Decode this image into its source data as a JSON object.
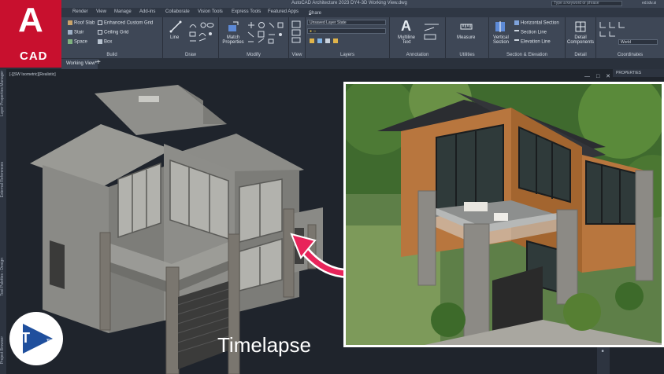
{
  "app": {
    "logo_letter": "A",
    "logo_text": "CAD",
    "window_title": "AutoCAD Architecture 2023   DY4-3D Working View.dwg",
    "search_placeholder": "Type a keyword or phrase",
    "user": "ed.tdv.si"
  },
  "ribbon_tabs": [
    "Render",
    "View",
    "Manage",
    "Add-ins",
    "Collaborate",
    "Vision Tools",
    "Express Tools",
    "Featured Apps"
  ],
  "share_label": "Share",
  "panels": {
    "build": {
      "title": "Build",
      "items": [
        "Roof Slab",
        "Stair",
        "Space",
        "Enhanced Custom Grid",
        "Ceiling Grid",
        "Box"
      ]
    },
    "draw": {
      "title": "Draw",
      "items": [
        "Line"
      ]
    },
    "modify": {
      "title": "Modify",
      "items": [
        "Match Properties"
      ]
    },
    "view": {
      "title": "View"
    },
    "layers": {
      "title": "Layers",
      "layer_state": "Unsaved Layer State"
    },
    "annotation": {
      "title": "Annotation",
      "items": [
        "Multiline Text"
      ]
    },
    "utilities": {
      "title": "Utilities",
      "items": [
        "Measure"
      ]
    },
    "section": {
      "title": "Section & Elevation",
      "items": [
        "Vertical Section",
        "Horizontal Section",
        "Section Line",
        "Elevation Line"
      ]
    },
    "detail": {
      "title": "Detail",
      "items": [
        "Detail Components"
      ]
    },
    "coordinates": {
      "title": "Coordinates",
      "ucs": "World"
    }
  },
  "file_tab": "Working View*",
  "viewport": {
    "label": "[-][SW Isometric][Realistic]",
    "controls": "— □ ✕"
  },
  "side_palettes": [
    "Layer Properties Manager",
    "External References",
    "Tool Palettes - Design",
    "Project Browser"
  ],
  "properties_label": "PROPERTIES",
  "caption": "Timelapse",
  "colors": {
    "logo_red": "#c8102e",
    "ribbon_bg": "#3e4756",
    "viewport_bg": "#1f242c",
    "arrow": "#e8245a",
    "model_gray": "#8a8a86"
  }
}
